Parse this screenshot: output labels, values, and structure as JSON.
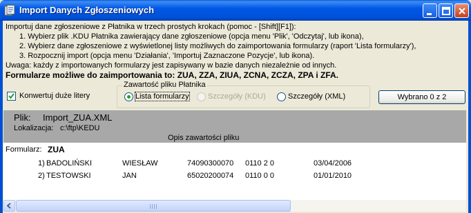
{
  "window": {
    "title": "Import Danych Zgłoszeniowych"
  },
  "instructions": {
    "line1": "Importuj dane zgłoszeniowe z Płatnika w trzech prostych krokach (pomoc - [Shift][F1]):",
    "step1": "1. Wybierz plik .KDU Płatnika zawierający dane zgłoszeniowe (opcja menu 'Plik', 'Odczytaj', lub ikona),",
    "step2": "2. Wybierz dane zgłoszeniowe z wyświetlonej listy możliwych do zaimportowania formularzy (raport 'Lista formularzy'),",
    "step3": "3. Rozpocznij import (opcja menu 'Działania', 'Importuj Zaznaczone Pozycje', lub ikona).",
    "note": "Uwaga: każdy z importowanych formularzy jest zapisywany w bazie danych niezależnie od innych.",
    "allowed_forms": "Formularze możliwe do zaimportowania to: ZUA, ZZA, ZIUA, ZCNA, ZCZA, ZPA i ZFA."
  },
  "options": {
    "convert_uppercase_label": "Konwertuj duże litery",
    "convert_uppercase_checked": true,
    "group_title": "Zawartość pliku Płatnika",
    "radios": [
      {
        "label": "Lista formularzy",
        "selected": true,
        "enabled": true
      },
      {
        "label": "Szczegóły (KDU)",
        "selected": false,
        "enabled": false
      },
      {
        "label": "Szczegóły (XML)",
        "selected": false,
        "enabled": true
      }
    ],
    "selection_button": "Wybrano 0 z 2"
  },
  "file_info": {
    "file_label": "Plik:",
    "file_name": "Import_ZUA.XML",
    "location_label": "Lokalizacja:",
    "location": "c:\\ftp\\KEDU",
    "content_desc": "Opis zawartości pliku"
  },
  "report": {
    "form_label": "Formularz:",
    "form_type": "ZUA",
    "rows": [
      {
        "lp": "1)",
        "surname": "BADOLIŃSKI",
        "name": "WIESŁAW",
        "pesel": "74090300070",
        "code": "0110 2 0",
        "date": "03/04/2006"
      },
      {
        "lp": "2)",
        "surname": "TESTOWSKI",
        "name": "JAN",
        "pesel": "65020200074",
        "code": "0110 0 0",
        "date": "01/01/2010"
      }
    ]
  },
  "colors": {
    "titlebar": "#0058E6",
    "window_bg": "#ECE9D8",
    "header_panel": "#A8A8A8",
    "radio_dot": "#21A121",
    "check_mark": "#21A121"
  }
}
